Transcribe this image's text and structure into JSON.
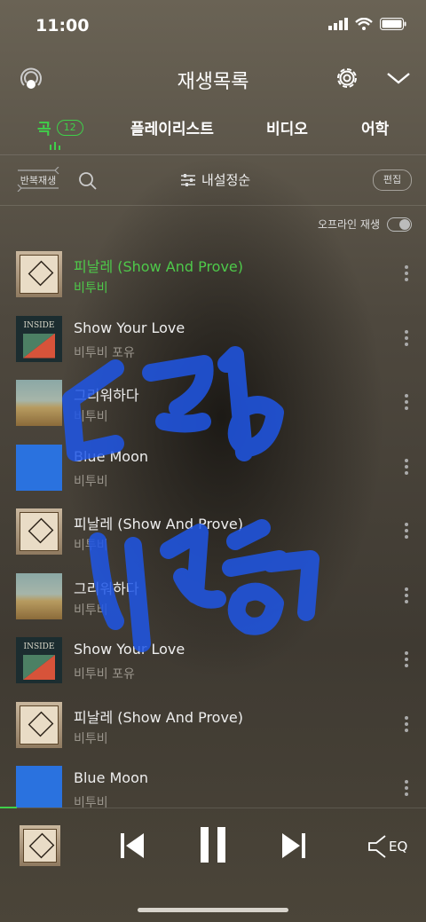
{
  "status": {
    "time": "11:00"
  },
  "header": {
    "title": "재생목록"
  },
  "tabs": [
    {
      "label": "곡",
      "count": "12"
    },
    {
      "label": "플레이리스트"
    },
    {
      "label": "비디오"
    },
    {
      "label": "어학"
    }
  ],
  "controls": {
    "repeat_label": "반복재생",
    "sort_label": "내설정순",
    "edit_label": "편집",
    "offline_label": "오프라인 재생",
    "offline_enabled": false
  },
  "songs": [
    {
      "title": "피날레 (Show And Prove)",
      "artist": "비투비",
      "art": "plain",
      "active": true
    },
    {
      "title": "Show Your Love",
      "artist": "비투비 포유",
      "art": "inside",
      "art_text": "INSIDE"
    },
    {
      "title": "그리워하다",
      "artist": "비투비",
      "art": "field"
    },
    {
      "title": "Blue Moon",
      "artist": "비투비",
      "art": "blue"
    },
    {
      "title": "피날레 (Show And Prove)",
      "artist": "비투비",
      "art": "plain"
    },
    {
      "title": "그리워하다",
      "artist": "비투비",
      "art": "field"
    },
    {
      "title": "Show Your Love",
      "artist": "비투비 포유",
      "art": "inside",
      "art_text": "INSIDE"
    },
    {
      "title": "피날레 (Show And Prove)",
      "artist": "비투비",
      "art": "plain"
    },
    {
      "title": "Blue Moon",
      "artist": "비투비",
      "art": "blue"
    }
  ],
  "player": {
    "eq_label": "EQ",
    "progress": 0.04
  },
  "colors": {
    "accent": "#3fd04a",
    "scribble": "#1f56e6"
  }
}
